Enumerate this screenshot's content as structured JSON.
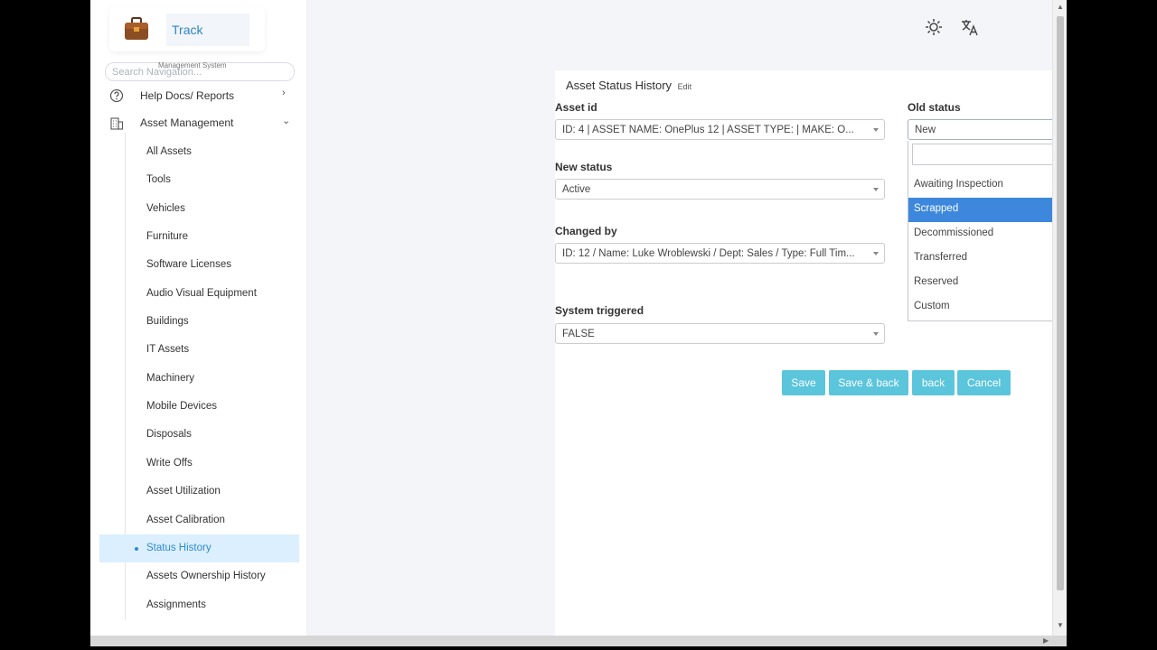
{
  "brand": {
    "title": "Track",
    "subtitle": "Management System"
  },
  "sidebar": {
    "search_placeholder": "Search Navigation...",
    "top_items": [
      {
        "label": "Help Docs/ Reports",
        "icon": "question-circle-icon",
        "chevron": "›"
      },
      {
        "label": "Asset Management",
        "icon": "building-icon",
        "chevron": "⌄"
      }
    ],
    "items": [
      {
        "label": "All Assets"
      },
      {
        "label": "Tools"
      },
      {
        "label": "Vehicles"
      },
      {
        "label": "Furniture"
      },
      {
        "label": "Software Licenses"
      },
      {
        "label": "Audio Visual Equipment"
      },
      {
        "label": "Buildings"
      },
      {
        "label": "IT Assets"
      },
      {
        "label": "Machinery"
      },
      {
        "label": "Mobile Devices"
      },
      {
        "label": "Disposals"
      },
      {
        "label": "Write Offs"
      },
      {
        "label": "Asset Utilization"
      },
      {
        "label": "Asset Calibration"
      },
      {
        "label": "Status History",
        "active": true
      },
      {
        "label": "Assets Ownership History"
      },
      {
        "label": "Assignments"
      }
    ]
  },
  "header_icons": [
    "sun-icon",
    "translate-icon",
    "user-avatar"
  ],
  "form": {
    "title": "Asset Status History",
    "title_suffix": "Edit",
    "asset_id": {
      "label": "Asset id",
      "value": "ID: 4 | ASSET NAME: OnePlus 12 | ASSET TYPE: | MAKE: O..."
    },
    "new_status": {
      "label": "New status",
      "value": "Active"
    },
    "changed_by": {
      "label": "Changed by",
      "value": "ID: 12 / Name: Luke Wroblewski / Dept: Sales / Type: Full Tim..."
    },
    "system_triggered": {
      "label": "System triggered",
      "value": "FALSE"
    },
    "old_status": {
      "label": "Old status",
      "value": "New",
      "search_value": "",
      "options": [
        "Awaiting Inspection",
        "Scrapped",
        "Decommissioned",
        "Transferred",
        "Reserved",
        "Custom"
      ],
      "highlighted": "Scrapped"
    }
  },
  "buttons": {
    "save": "Save",
    "save_back": "Save & back",
    "back": "back",
    "cancel": "Cancel"
  },
  "colors": {
    "accent": "#5bc5dc",
    "highlight": "#3d88dc",
    "active_nav_bg": "#dcefff",
    "active_nav_text": "#2b8bd4"
  }
}
